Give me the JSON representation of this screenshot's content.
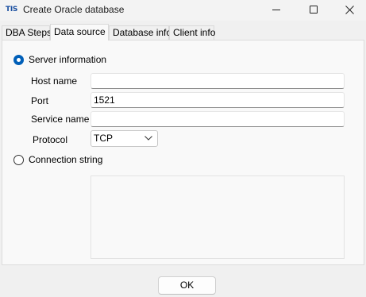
{
  "window": {
    "icon_text": "TIS",
    "title": "Create Oracle database"
  },
  "tabs": [
    {
      "label": "DBA Steps",
      "active": false
    },
    {
      "label": "Data source",
      "active": true
    },
    {
      "label": "Database info",
      "active": false
    },
    {
      "label": "Client info",
      "active": false
    }
  ],
  "data_source": {
    "server_info_label": "Server information",
    "server_info_selected": true,
    "host_name_label": "Host name",
    "host_name_value": "",
    "port_label": "Port",
    "port_value": "1521",
    "service_name_label": "Service name",
    "service_name_value": "",
    "protocol_label": "Protocol",
    "protocol_value": "TCP",
    "connection_string_label": "Connection string",
    "connection_string_selected": false,
    "connection_string_value": ""
  },
  "footer": {
    "ok_label": "OK"
  },
  "colors": {
    "accent": "#005fb8",
    "icon_blue": "#1a4fa0"
  }
}
